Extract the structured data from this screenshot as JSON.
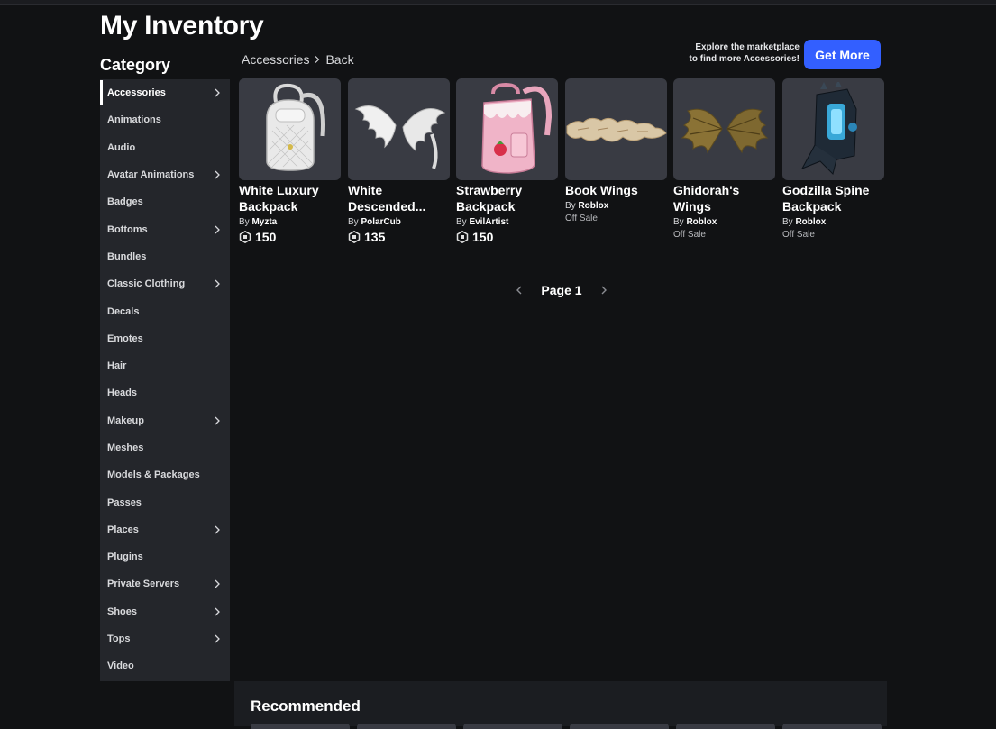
{
  "page": {
    "title": "My Inventory",
    "category_heading": "Category"
  },
  "sidebar": {
    "items": [
      {
        "label": "Accessories",
        "chevron": true,
        "active": true
      },
      {
        "label": "Animations",
        "chevron": false
      },
      {
        "label": "Audio",
        "chevron": false
      },
      {
        "label": "Avatar Animations",
        "chevron": true
      },
      {
        "label": "Badges",
        "chevron": false
      },
      {
        "label": "Bottoms",
        "chevron": true
      },
      {
        "label": "Bundles",
        "chevron": false
      },
      {
        "label": "Classic Clothing",
        "chevron": true
      },
      {
        "label": "Decals",
        "chevron": false
      },
      {
        "label": "Emotes",
        "chevron": false
      },
      {
        "label": "Hair",
        "chevron": false
      },
      {
        "label": "Heads",
        "chevron": false
      },
      {
        "label": "Makeup",
        "chevron": true
      },
      {
        "label": "Meshes",
        "chevron": false
      },
      {
        "label": "Models & Packages",
        "chevron": false
      },
      {
        "label": "Passes",
        "chevron": false
      },
      {
        "label": "Places",
        "chevron": true
      },
      {
        "label": "Plugins",
        "chevron": false
      },
      {
        "label": "Private Servers",
        "chevron": true
      },
      {
        "label": "Shoes",
        "chevron": true
      },
      {
        "label": "Tops",
        "chevron": true
      },
      {
        "label": "Video",
        "chevron": false
      }
    ]
  },
  "breadcrumb": {
    "current": "Accessories",
    "back": "Back"
  },
  "promo": {
    "line1": "Explore the marketplace",
    "line2": "to find more Accessories!",
    "button": "Get More"
  },
  "items": [
    {
      "name": "White Luxury Backpack",
      "by": "By",
      "creator": "Myzta",
      "price": "150",
      "off_sale": "",
      "icon": "white-backpack-icon"
    },
    {
      "name": "White Descended...",
      "by": "By",
      "creator": "PolarCub",
      "price": "135",
      "off_sale": "",
      "icon": "white-wings-icon"
    },
    {
      "name": "Strawberry Backpack",
      "by": "By",
      "creator": "EvilArtist",
      "price": "150",
      "off_sale": "",
      "icon": "pink-backpack-icon"
    },
    {
      "name": "Book Wings",
      "by": "By",
      "creator": "Roblox",
      "price": "",
      "off_sale": "Off Sale",
      "icon": "book-wings-icon"
    },
    {
      "name": "Ghidorah's Wings",
      "by": "By",
      "creator": "Roblox",
      "price": "",
      "off_sale": "Off Sale",
      "icon": "dragon-wings-icon"
    },
    {
      "name": "Godzilla Spine Backpack",
      "by": "By",
      "creator": "Roblox",
      "price": "",
      "off_sale": "Off Sale",
      "icon": "spine-backpack-icon"
    }
  ],
  "pager": {
    "label": "Page 1"
  },
  "recommended": {
    "title": "Recommended"
  },
  "colors": {
    "accent": "#335fff",
    "sidebar_bg": "#24262b",
    "card_bg": "#393b43",
    "page_bg": "#111214"
  }
}
